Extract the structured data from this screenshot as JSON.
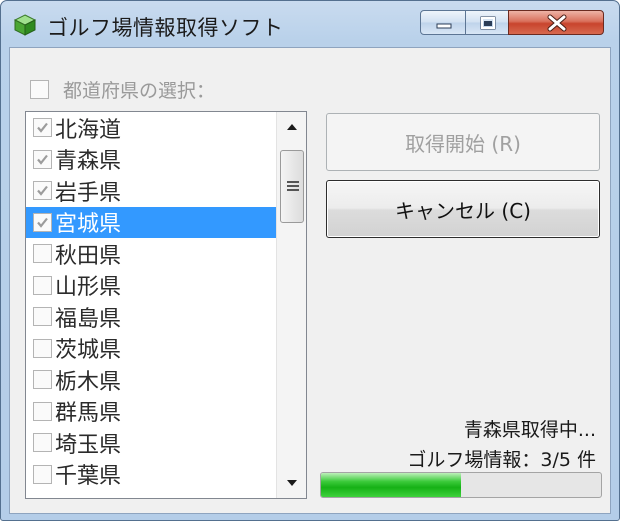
{
  "window": {
    "title": "ゴルフ場情報取得ソフト",
    "icon": "green-cube-icon"
  },
  "select_all": {
    "label": "都道府県の選択：",
    "checked": false
  },
  "prefectures": [
    {
      "label": "北海道",
      "checked": true,
      "selected": false
    },
    {
      "label": "青森県",
      "checked": true,
      "selected": false
    },
    {
      "label": "岩手県",
      "checked": true,
      "selected": false
    },
    {
      "label": "宮城県",
      "checked": true,
      "selected": true
    },
    {
      "label": "秋田県",
      "checked": false,
      "selected": false
    },
    {
      "label": "山形県",
      "checked": false,
      "selected": false
    },
    {
      "label": "福島県",
      "checked": false,
      "selected": false
    },
    {
      "label": "茨城県",
      "checked": false,
      "selected": false
    },
    {
      "label": "栃木県",
      "checked": false,
      "selected": false
    },
    {
      "label": "群馬県",
      "checked": false,
      "selected": false
    },
    {
      "label": "埼玉県",
      "checked": false,
      "selected": false
    },
    {
      "label": "千葉県",
      "checked": false,
      "selected": false
    }
  ],
  "buttons": {
    "start": "取得開始 (R)",
    "cancel": "キャンセル (C)"
  },
  "status": {
    "line1": "青森県取得中...",
    "line2": "ゴルフ場情報：3/5 件"
  },
  "progress": {
    "fraction": 0.5
  },
  "colors": {
    "selection": "#3399ff",
    "progress": "#16b116",
    "close_button": "#c8442d"
  }
}
